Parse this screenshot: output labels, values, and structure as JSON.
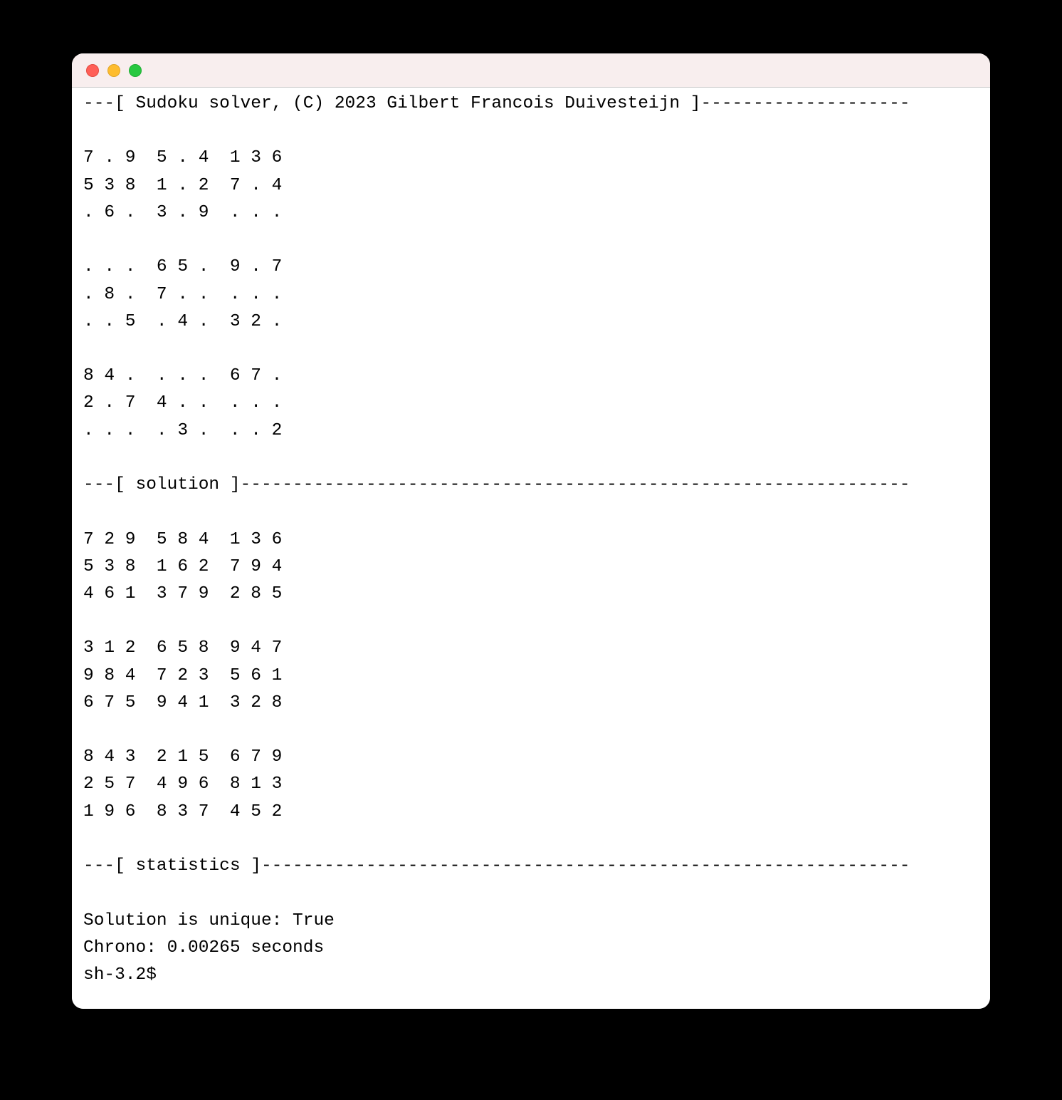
{
  "headers": {
    "title": "Sudoku solver, (C) 2023 Gilbert Francois Duivesteijn",
    "solution": "solution",
    "statistics": "statistics"
  },
  "puzzle": [
    [
      "7",
      ".",
      "9",
      "5",
      ".",
      "4",
      "1",
      "3",
      "6"
    ],
    [
      "5",
      "3",
      "8",
      "1",
      ".",
      "2",
      "7",
      ".",
      "4"
    ],
    [
      ".",
      "6",
      ".",
      "3",
      ".",
      "9",
      ".",
      ".",
      "."
    ],
    [
      ".",
      ".",
      ".",
      "6",
      "5",
      ".",
      "9",
      ".",
      "7"
    ],
    [
      ".",
      "8",
      ".",
      "7",
      ".",
      ".",
      ".",
      ".",
      "."
    ],
    [
      ".",
      ".",
      "5",
      ".",
      "4",
      ".",
      "3",
      "2",
      "."
    ],
    [
      "8",
      "4",
      ".",
      ".",
      ".",
      ".",
      "6",
      "7",
      "."
    ],
    [
      "2",
      ".",
      "7",
      "4",
      ".",
      ".",
      ".",
      ".",
      "."
    ],
    [
      ".",
      ".",
      ".",
      ".",
      "3",
      ".",
      ".",
      ".",
      "2"
    ]
  ],
  "solution": [
    [
      "7",
      "2",
      "9",
      "5",
      "8",
      "4",
      "1",
      "3",
      "6"
    ],
    [
      "5",
      "3",
      "8",
      "1",
      "6",
      "2",
      "7",
      "9",
      "4"
    ],
    [
      "4",
      "6",
      "1",
      "3",
      "7",
      "9",
      "2",
      "8",
      "5"
    ],
    [
      "3",
      "1",
      "2",
      "6",
      "5",
      "8",
      "9",
      "4",
      "7"
    ],
    [
      "9",
      "8",
      "4",
      "7",
      "2",
      "3",
      "5",
      "6",
      "1"
    ],
    [
      "6",
      "7",
      "5",
      "9",
      "4",
      "1",
      "3",
      "2",
      "8"
    ],
    [
      "8",
      "4",
      "3",
      "2",
      "1",
      "5",
      "6",
      "7",
      "9"
    ],
    [
      "2",
      "5",
      "7",
      "4",
      "9",
      "6",
      "8",
      "1",
      "3"
    ],
    [
      "1",
      "9",
      "6",
      "8",
      "3",
      "7",
      "4",
      "5",
      "2"
    ]
  ],
  "stats": {
    "unique_label": "Solution is unique:",
    "unique_value": "True",
    "chrono_label": "Chrono:",
    "chrono_value": "0.00265 seconds"
  },
  "prompt": "sh-3.2$",
  "line_width": 79
}
